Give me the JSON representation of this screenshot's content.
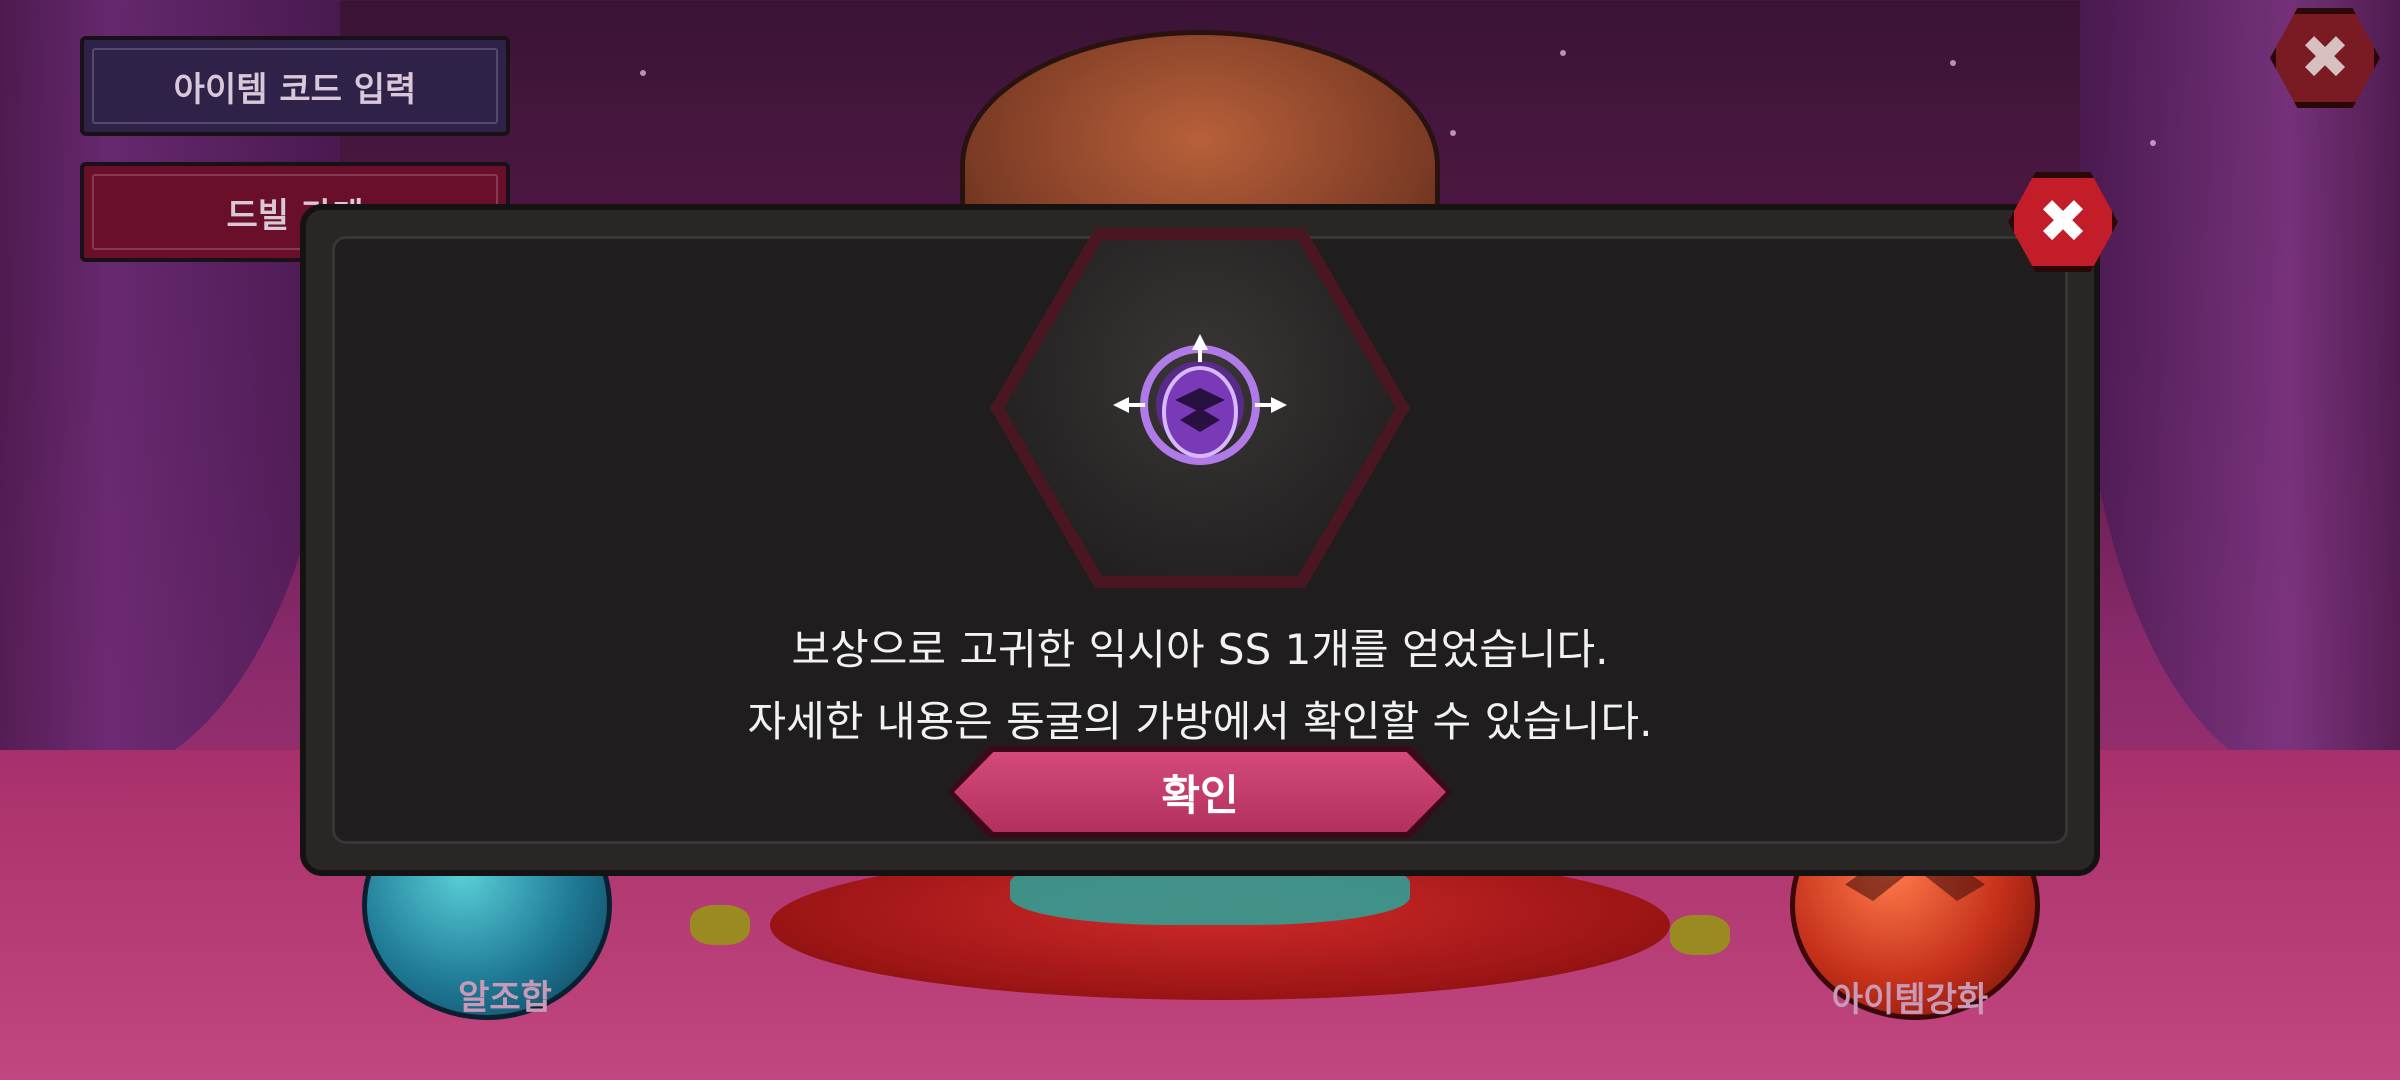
{
  "top_buttons": {
    "item_code_label": "아이템 코드 입력",
    "drill_label": "드빌 가게"
  },
  "bottom_orbs": {
    "alchemy_label": "알조합",
    "item_upgrade_label": "아이템강화"
  },
  "dialog": {
    "message_line1": "보상으로 고귀한 익시아 SS 1개를 얻었습니다.",
    "message_line2": "자세한 내용은 동굴의 가방에서 확인할 수 있습니다.",
    "confirm_label": "확인",
    "reward_icon": "purple-emblem-icon"
  },
  "icons": {
    "close_glyph": "✖"
  },
  "colors": {
    "close_red": "#c41d2a",
    "confirm_pink": "#c23a6a",
    "dialog_bg": "#1f1d1d"
  }
}
